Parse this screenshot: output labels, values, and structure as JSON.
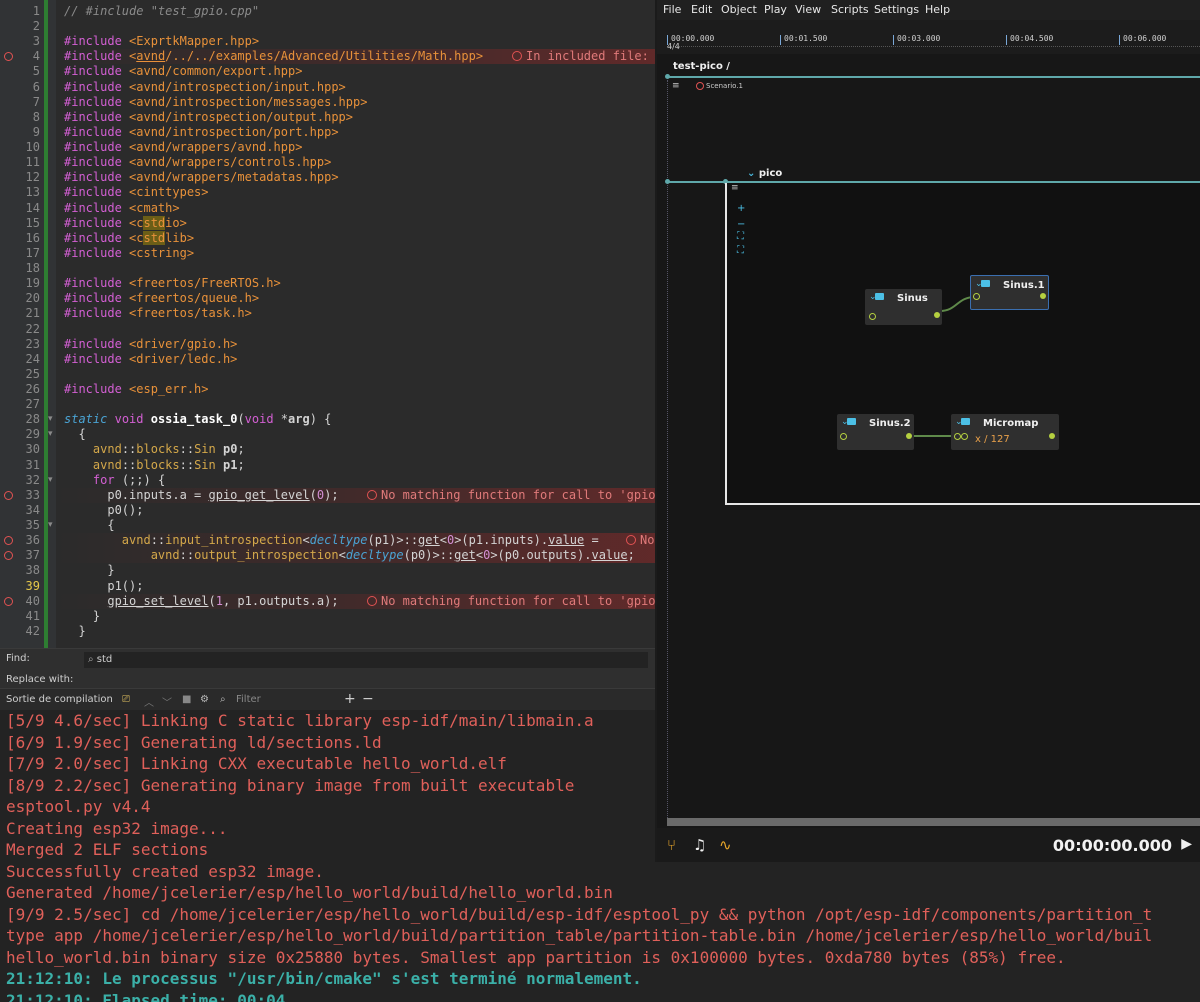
{
  "editor": {
    "lines": [
      {
        "n": "1",
        "html": "<span class='cm'>// #include \"test_gpio.cpp\"</span>"
      },
      {
        "n": "2",
        "html": ""
      },
      {
        "n": "3",
        "html": "<span class='kw'>#include</span> <span class='hd'>&lt;ExprtkMapper.hpp&gt;</span>"
      },
      {
        "n": "4",
        "err": true,
        "html": "<span class='kw'>#include</span> <span class='hd'>&lt;<u>avnd</u>/../../examples/Advanced/Utilities/Math.hpp&gt;</span>"
      },
      {
        "n": "5",
        "html": "<span class='kw'>#include</span> <span class='hd'>&lt;avnd/common/export.hpp&gt;</span>"
      },
      {
        "n": "6",
        "html": "<span class='kw'>#include</span> <span class='hd'>&lt;avnd/introspection/input.hpp&gt;</span>"
      },
      {
        "n": "7",
        "html": "<span class='kw'>#include</span> <span class='hd'>&lt;avnd/introspection/messages.hpp&gt;</span>"
      },
      {
        "n": "8",
        "html": "<span class='kw'>#include</span> <span class='hd'>&lt;avnd/introspection/output.hpp&gt;</span>"
      },
      {
        "n": "9",
        "html": "<span class='kw'>#include</span> <span class='hd'>&lt;avnd/introspection/port.hpp&gt;</span>"
      },
      {
        "n": "10",
        "html": "<span class='kw'>#include</span> <span class='hd'>&lt;avnd/wrappers/avnd.hpp&gt;</span>"
      },
      {
        "n": "11",
        "html": "<span class='kw'>#include</span> <span class='hd'>&lt;avnd/wrappers/controls.hpp&gt;</span>"
      },
      {
        "n": "12",
        "html": "<span class='kw'>#include</span> <span class='hd'>&lt;avnd/wrappers/metadatas.hpp&gt;</span>"
      },
      {
        "n": "13",
        "html": "<span class='kw'>#include</span> <span class='hd'>&lt;cinttypes&gt;</span>"
      },
      {
        "n": "14",
        "html": "<span class='kw'>#include</span> <span class='hd'>&lt;cmath&gt;</span>"
      },
      {
        "n": "15",
        "html": "<span class='kw'>#include</span> <span class='hd'>&lt;c<span class='hl'>std</span>io&gt;</span>"
      },
      {
        "n": "16",
        "html": "<span class='kw'>#include</span> <span class='hd'>&lt;c<span class='hl'>std</span>lib&gt;</span>"
      },
      {
        "n": "17",
        "html": "<span class='kw'>#include</span> <span class='hd'>&lt;cstring&gt;</span>"
      },
      {
        "n": "18",
        "html": ""
      },
      {
        "n": "19",
        "html": "<span class='kw'>#include</span> <span class='hd'>&lt;freertos/FreeRTOS.h&gt;</span>"
      },
      {
        "n": "20",
        "html": "<span class='kw'>#include</span> <span class='hd'>&lt;freertos/queue.h&gt;</span>"
      },
      {
        "n": "21",
        "html": "<span class='kw'>#include</span> <span class='hd'>&lt;freertos/task.h&gt;</span>"
      },
      {
        "n": "22",
        "html": ""
      },
      {
        "n": "23",
        "html": "<span class='kw'>#include</span> <span class='hd'>&lt;driver/gpio.h&gt;</span>"
      },
      {
        "n": "24",
        "html": "<span class='kw'>#include</span> <span class='hd'>&lt;driver/ledc.h&gt;</span>"
      },
      {
        "n": "25",
        "html": ""
      },
      {
        "n": "26",
        "html": "<span class='kw'>#include</span> <span class='hd'>&lt;esp_err.h&gt;</span>"
      },
      {
        "n": "27",
        "html": ""
      },
      {
        "n": "28",
        "fold": true,
        "html": "<span class='it'>static</span> <span class='kw'>void</span> <span class='fn'>ossia_task_0</span>(<span class='kw'>void</span> *<b>arg</b>) {"
      },
      {
        "n": "29",
        "fold": true,
        "html": "  {"
      },
      {
        "n": "30",
        "html": "    <span class='ns'>avnd</span>::<span class='ns'>blocks</span>::<span class='ns'>Sin</span> <b>p0</b>;"
      },
      {
        "n": "31",
        "html": "    <span class='ns'>avnd</span>::<span class='ns'>blocks</span>::<span class='ns'>Sin</span> <b>p1</b>;"
      },
      {
        "n": "32",
        "fold": true,
        "html": "    <span class='kw'>for</span> (;;) {"
      },
      {
        "n": "33",
        "err": true,
        "html": "      p0.inputs.a = <u>gpio_get_level</u>(<span class='num'>0</span>);"
      },
      {
        "n": "34",
        "html": "      p0();"
      },
      {
        "n": "35",
        "fold": true,
        "html": "      {"
      },
      {
        "n": "36",
        "err": true,
        "html": "        <span class='ns'>avnd</span>::<span class='ns'>input_introspection</span>&lt;<span class='it'>decltype</span>(p1)&gt;::<u>get</u>&lt;<span class='num'>0</span>&gt;(p1.inputs).<u>value</u> ="
      },
      {
        "n": "37",
        "err": true,
        "html": "            <span class='ns'>avnd</span>::<span class='ns'>output_introspection</span>&lt;<span class='it'>decltype</span>(p0)&gt;::<u>get</u>&lt;<span class='num'>0</span>&gt;(p0.outputs).<u>value</u>;"
      },
      {
        "n": "38",
        "html": "      }"
      },
      {
        "n": "39",
        "cur": true,
        "html": "      p1();"
      },
      {
        "n": "40",
        "err": true,
        "html": "      <u>gpio_set_level</u>(<span class='num'>1</span>, p1.outputs.a);"
      },
      {
        "n": "41",
        "html": "    }"
      },
      {
        "n": "42",
        "html": "  }"
      }
    ],
    "errors": [
      {
        "line": 4,
        "text": "In included file:"
      },
      {
        "line": 33,
        "text": "No matching function for call to 'gpio"
      },
      {
        "line": 36,
        "text": "No"
      },
      {
        "line": 40,
        "text": "No matching function for call to 'gpio"
      }
    ],
    "find_label": "Find:",
    "find_value": "std",
    "replace_label": "Replace with:"
  },
  "output_bar": {
    "title": "Sortie de compilation",
    "filter_placeholder": "Filter"
  },
  "output": {
    "lines": [
      {
        "t": "[5/9 4.6/sec] Linking C static library esp-idf/main/libmain.a"
      },
      {
        "t": "[6/9 1.9/sec] Generating ld/sections.ld"
      },
      {
        "t": "[7/9 2.0/sec] Linking CXX executable hello_world.elf"
      },
      {
        "t": "[8/9 2.2/sec] Generating binary image from built executable"
      },
      {
        "t": "esptool.py v4.4"
      },
      {
        "t": "Creating esp32 image..."
      },
      {
        "t": "Merged 2 ELF sections"
      },
      {
        "t": "Successfully created esp32 image."
      },
      {
        "t": "Generated /home/jcelerier/esp/hello_world/build/hello_world.bin"
      },
      {
        "t": "[9/9 2.5/sec] cd /home/jcelerier/esp/hello_world/build/esp-idf/esptool_py && python /opt/esp-idf/components/partition_t"
      },
      {
        "t": "type app /home/jcelerier/esp/hello_world/build/partition_table/partition-table.bin /home/jcelerier/esp/hello_world/buil"
      },
      {
        "t": "hello_world.bin binary size 0x25880 bytes. Smallest app partition is 0x100000 bytes. 0xda780 bytes (85%) free."
      },
      {
        "t": "21:12:10: Le processus \"/usr/bin/cmake\" s'est terminé normalement.",
        "teal": true
      },
      {
        "t": "21:12:10: Elapsed time: 00:04.",
        "teal": true
      }
    ]
  },
  "score": {
    "menu": [
      "File",
      "Edit",
      "Object",
      "Play",
      "View",
      "Scripts",
      "Settings",
      "Help"
    ],
    "ruler_labels": [
      "00:00.000",
      "00:01.500",
      "00:03.000",
      "00:04.500",
      "00:06.000"
    ],
    "signature": "4/4",
    "breadcrumb": "test-pico /",
    "scenario_label": "Scenario.1",
    "interval_label": "pico",
    "nodes": {
      "sinus": "Sinus",
      "sinus1": "Sinus.1",
      "sinus2": "Sinus.2",
      "micromap": "Micromap",
      "micromap_expr": "x / 127"
    },
    "timecode": "00:00:00.000",
    "accent_color": "#5fa8aa",
    "pin_color": "#b5d040"
  }
}
